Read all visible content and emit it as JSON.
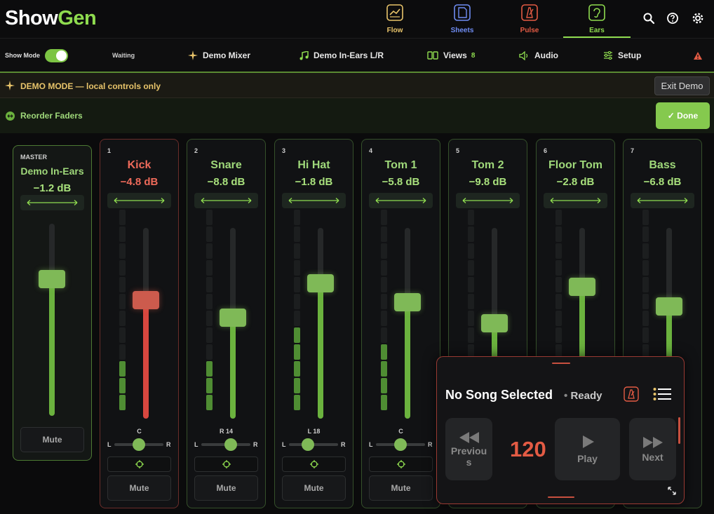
{
  "app": {
    "logo_a": "Show",
    "logo_b": "Gen"
  },
  "nav": {
    "tabs": [
      {
        "label": "Flow",
        "icon": "flow-icon",
        "color": "#e8c46a"
      },
      {
        "label": "Sheets",
        "icon": "sheets-icon",
        "color": "#6f8cf2"
      },
      {
        "label": "Pulse",
        "icon": "metronome-icon",
        "color": "#e35b44"
      },
      {
        "label": "Ears",
        "icon": "ear-icon",
        "color": "#8fdc4f",
        "active": true
      }
    ],
    "icons": [
      "search-icon",
      "help-icon",
      "gear-icon"
    ]
  },
  "toolbar": {
    "show_mode_label": "Show Mode",
    "show_mode_on": true,
    "status": "Waiting",
    "mixer_name": "Demo Mixer",
    "ears_mix": "Demo In-Ears L/R",
    "views_label": "Views",
    "views_count": "8",
    "audio_label": "Audio",
    "setup_label": "Setup",
    "alert_icon": "warning-icon"
  },
  "demo_banner": {
    "text": "DEMO MODE — local controls only",
    "exit_label": "Exit Demo"
  },
  "reorder": {
    "text": "Reorder Faders",
    "done_label": "✓  Done"
  },
  "master": {
    "tag": "MASTER",
    "name": "Demo In-Ears",
    "db": "−1.2 dB",
    "level": 0.71,
    "mute_label": "Mute"
  },
  "channels": [
    {
      "num": "1",
      "name": "Kick",
      "db": "−4.8 dB",
      "level": 0.62,
      "pan": "C",
      "pan_pos": 0.5,
      "meter": 3,
      "color": "red",
      "mute_label": "Mute"
    },
    {
      "num": "2",
      "name": "Snare",
      "db": "−8.8 dB",
      "level": 0.53,
      "pan": "R 14",
      "pan_pos": 0.6,
      "meter": 3,
      "color": "green",
      "mute_label": "Mute"
    },
    {
      "num": "3",
      "name": "Hi Hat",
      "db": "−1.8 dB",
      "level": 0.71,
      "pan": "L 18",
      "pan_pos": 0.38,
      "meter": 5,
      "color": "green",
      "mute_label": "Mute"
    },
    {
      "num": "4",
      "name": "Tom 1",
      "db": "−5.8 dB",
      "level": 0.61,
      "pan": "C",
      "pan_pos": 0.5,
      "meter": 4,
      "color": "green",
      "mute_label": "Mute"
    },
    {
      "num": "5",
      "name": "Tom 2",
      "db": "−9.8 dB",
      "level": 0.5,
      "pan": "",
      "pan_pos": 0.5,
      "meter": 0,
      "color": "green",
      "mute_label": ""
    },
    {
      "num": "6",
      "name": "Floor Tom",
      "db": "−2.8 dB",
      "level": 0.69,
      "pan": "",
      "pan_pos": 0.5,
      "meter": 0,
      "color": "green",
      "mute_label": ""
    },
    {
      "num": "7",
      "name": "Bass",
      "db": "−6.8 dB",
      "level": 0.59,
      "pan": "",
      "pan_pos": 0.5,
      "meter": 0,
      "color": "green",
      "mute_label": ""
    }
  ],
  "pan_left": "L",
  "pan_right": "R",
  "transport": {
    "song": "No Song Selected",
    "status": "Ready",
    "tempo": "120",
    "prev_label": "Previou s",
    "play_label": "Play",
    "next_label": "Next"
  }
}
